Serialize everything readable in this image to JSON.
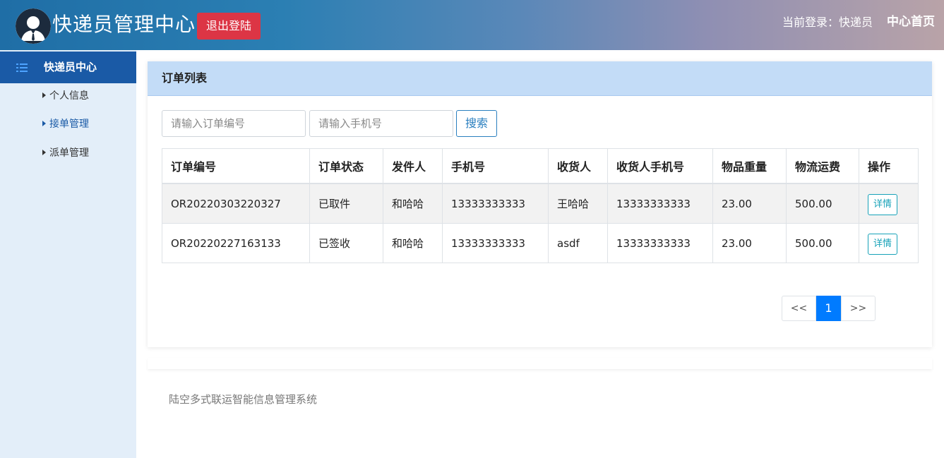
{
  "header": {
    "title": "快递员管理中心",
    "logout_label": "退出登陆",
    "login_info": "当前登录：快递员",
    "home_label": "中心首页"
  },
  "sidebar": {
    "section_label": "快递员中心",
    "items": [
      {
        "label": "个人信息",
        "active": false
      },
      {
        "label": "接单管理",
        "active": true
      },
      {
        "label": "派单管理",
        "active": false
      }
    ]
  },
  "main": {
    "card_title": "订单列表",
    "search": {
      "order_no_placeholder": "请输入订单编号",
      "order_no_value": "",
      "phone_placeholder": "请输入手机号",
      "phone_value": "",
      "button_label": "搜索"
    },
    "table": {
      "columns": [
        "订单编号",
        "订单状态",
        "发件人",
        "手机号",
        "收货人",
        "收货人手机号",
        "物品重量",
        "物流运费",
        "操作"
      ],
      "rows": [
        {
          "order_no": "OR20220303220327",
          "status": "已取件",
          "sender": "和哈哈",
          "phone": "13333333333",
          "receiver": "王哈哈",
          "receiver_phone": "13333333333",
          "weight": "23.00",
          "fee": "500.00",
          "action": "详情"
        },
        {
          "order_no": "OR20220227163133",
          "status": "已签收",
          "sender": "和哈哈",
          "phone": "13333333333",
          "receiver": "asdf",
          "receiver_phone": "13333333333",
          "weight": "23.00",
          "fee": "500.00",
          "action": "详情"
        }
      ]
    },
    "pagination": {
      "prev": "<<",
      "current": "1",
      "next": ">>"
    }
  },
  "footer": {
    "text": "陆空多式联运智能信息管理系统"
  },
  "colors": {
    "logout_button": "#dc3545",
    "sidebar_active_bg": "#1a5aa6",
    "card_header_bg": "#c3dcf7",
    "pager_active": "#007bff",
    "detail_button": "#17a2b8"
  }
}
